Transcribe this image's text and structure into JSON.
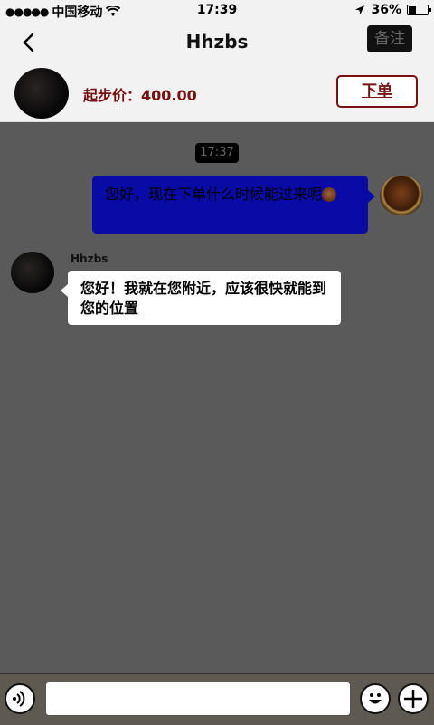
{
  "status_bar": {
    "signal_dots": "●●●●●",
    "carrier": "中国移动",
    "time": "17:39",
    "battery": "36%",
    "battery_level": 0.36
  },
  "nav": {
    "title": "Hhzbs",
    "note_button": "备注"
  },
  "merchant": {
    "price_text": "起步价：400.00",
    "order_button": "下单"
  },
  "chat": {
    "timestamp": "17:37",
    "messages": [
      {
        "direction": "outgoing",
        "text": "您好，现在下单什么时候能过来呢"
      },
      {
        "direction": "incoming",
        "sender": "Hhzbs",
        "text": "您好！我就在您附近，应该很快就能到您的位置"
      }
    ]
  },
  "input_bar": {
    "placeholder": "",
    "icons": [
      "voice-icon",
      "emoji-icon",
      "plus-icon"
    ]
  },
  "colors": {
    "accent": "#7a1010",
    "outgoing_bubble": "#0a0aa6",
    "background": "#5a5a5a"
  }
}
